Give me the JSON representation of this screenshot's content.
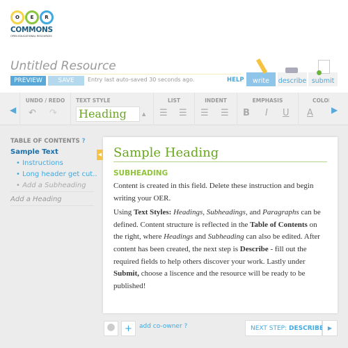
{
  "logo": {
    "letters": [
      "O",
      "E",
      "R"
    ],
    "name": "COMMONS",
    "tagline": "OPEN EDUCATIONAL RESOURCES",
    "colors": [
      "#f5d44a",
      "#8cc63f",
      "#3fa9e0"
    ]
  },
  "header": {
    "title": "Untitled Resource",
    "preview": "PREVIEW",
    "save": "SAVE",
    "autosave": "Entry last auto-saved 30 seconds ago.",
    "help": "HELP",
    "tabs": [
      {
        "label": "write",
        "active": true
      },
      {
        "label": "describe"
      },
      {
        "label": "submit"
      }
    ]
  },
  "toolbar": {
    "groups": [
      "UNDO / REDO",
      "TEXT STYLE",
      "LIST",
      "INDENT",
      "EMPHASIS",
      "COLOR"
    ],
    "text_style_value": "Heading",
    "bold": "B",
    "italic": "I",
    "underline": "U",
    "color": "A"
  },
  "toc": {
    "title": "TABLE OF CONTENTS",
    "items": [
      {
        "label": "Sample Text",
        "level": 1
      },
      {
        "label": "Instructions",
        "level": 2
      },
      {
        "label": "Long header get cut..",
        "level": 2
      },
      {
        "label": "Add a Subheading",
        "level": 2,
        "placeholder": true
      },
      {
        "label": "Add a Heading",
        "level": 1,
        "placeholder": true
      }
    ]
  },
  "editor": {
    "heading": "Sample Heading",
    "subheading": "SUBHEADING",
    "p1": "Content is created in this field. Delete these instruction and begin writing your OER.",
    "p2": {
      "a": "Using ",
      "b": "Text Styles:",
      "c": " Headings, Subheadings,",
      "d": " and ",
      "e": "Paragraphs",
      "f": " can be defined. Content structure is reflected in the ",
      "g": "Table of Contents",
      "h": " on the right, where ",
      "i": "Headings",
      "j": " and ",
      "k": "Subheading",
      "l": " can also be edited. After content has been created, the next step is ",
      "m": "Describe",
      "n": " - fill out the required fields to help others discover your work. Lastly under ",
      "o": "Submit,",
      "p": " choose a liscence and the resource will be ready to be published!"
    }
  },
  "footer": {
    "add_coowner": "add co-owner",
    "next_step": "NEXT STEP:",
    "next_target": "DESCRIBE"
  }
}
